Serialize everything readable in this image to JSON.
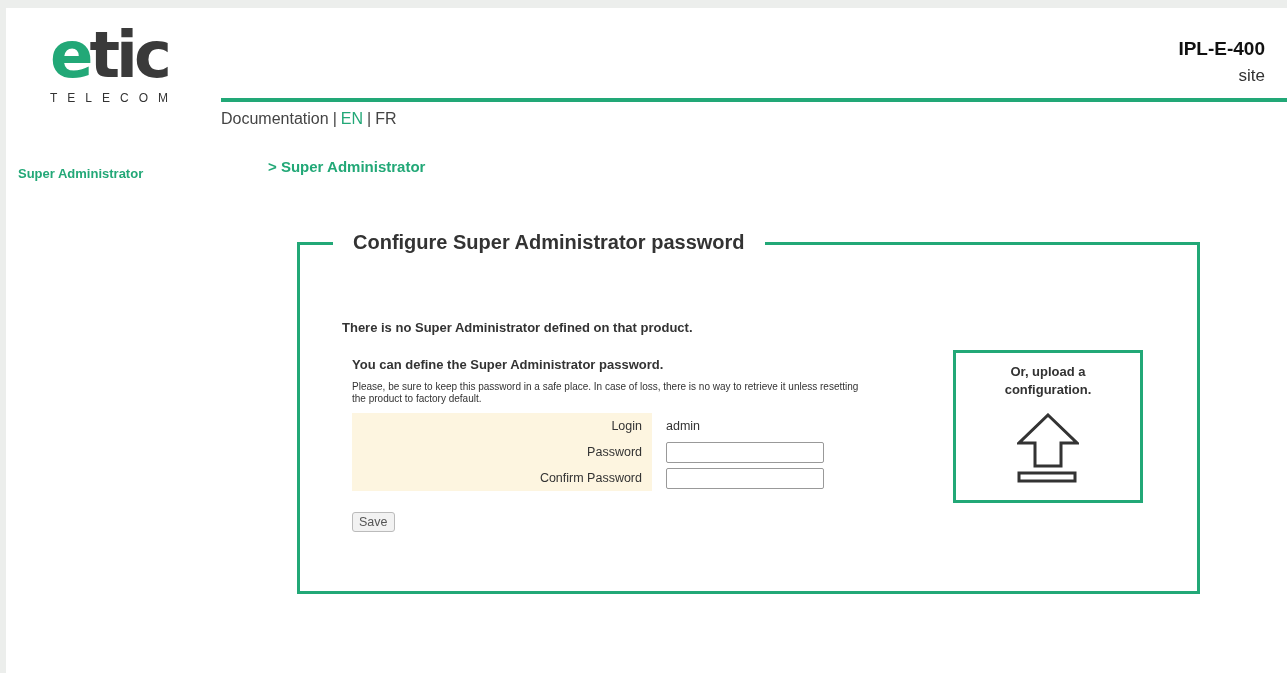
{
  "logo": {
    "wordmark": "etic",
    "tagline": "TELECOM"
  },
  "product": {
    "model": "IPL-E-400",
    "site": "site"
  },
  "nav": {
    "items": [
      {
        "label": "Documentation",
        "selected": false
      },
      {
        "label": "EN",
        "selected": true
      },
      {
        "label": "FR",
        "selected": false
      }
    ],
    "separators": [
      "|",
      "|"
    ]
  },
  "sidebar": {
    "items": [
      {
        "label": "Super Administrator",
        "selected": true
      }
    ]
  },
  "breadcrumb": "> Super Administrator",
  "panel": {
    "title": "Configure Super Administrator password",
    "notice": "There is no Super Administrator defined on that product.",
    "heading": "You can define the Super Administrator password.",
    "warning": "Please, be sure to keep this password in a safe place. In case of loss, there is no way to retrieve it unless resetting the product to factory default.",
    "fields": [
      {
        "kind": "text",
        "label": "Login",
        "value": "admin"
      },
      {
        "kind": "input",
        "label": "Password"
      },
      {
        "kind": "input",
        "label": "Confirm Password"
      }
    ],
    "save_button": "Save",
    "upload": {
      "label": "Or, upload a configuration."
    }
  }
}
